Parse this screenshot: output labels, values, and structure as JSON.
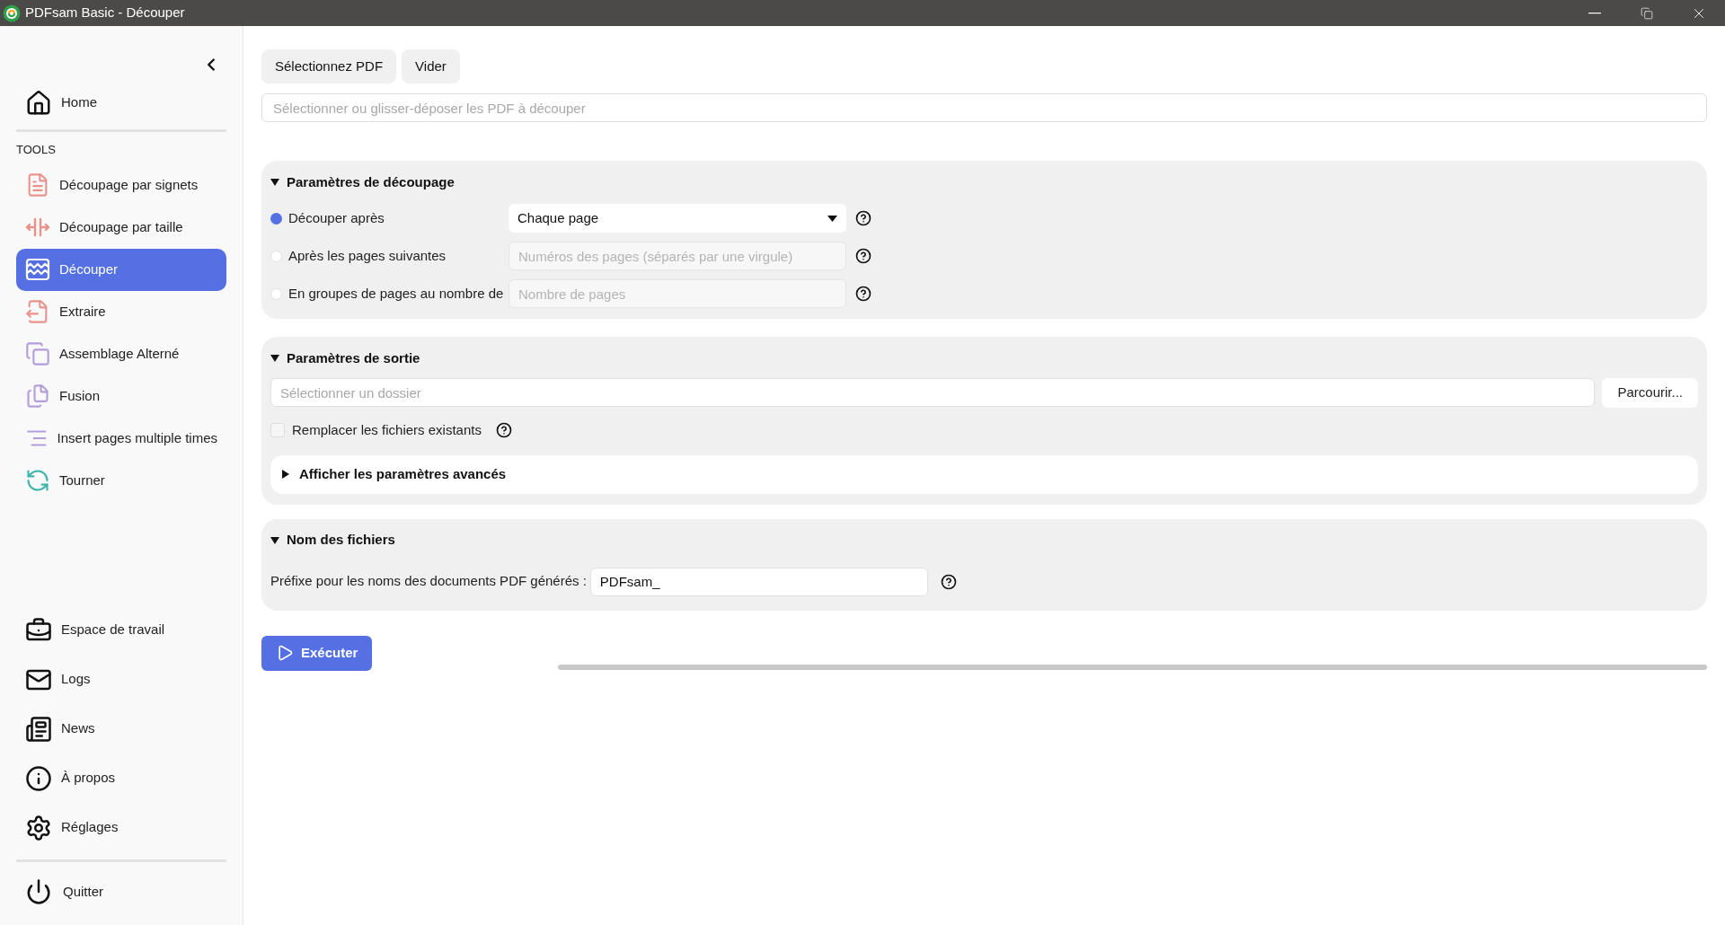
{
  "window": {
    "title": "PDFsam Basic - Découper"
  },
  "sidebar": {
    "top_items": [
      {
        "label": "Home",
        "selected": false
      }
    ],
    "section_label": "TOOLS",
    "tools": [
      {
        "label": "Découpage par signets",
        "selected": false
      },
      {
        "label": "Découpage par taille",
        "selected": false
      },
      {
        "label": "Découper",
        "selected": true
      },
      {
        "label": "Extraire",
        "selected": false
      },
      {
        "label": "Assemblage Alterné",
        "selected": false
      },
      {
        "label": "Fusion",
        "selected": false
      },
      {
        "label": "Insert pages multiple times",
        "selected": false
      },
      {
        "label": "Tourner",
        "selected": false
      }
    ],
    "bottom_items": [
      {
        "label": "Espace de travail",
        "selected": false
      },
      {
        "label": "Logs",
        "selected": false
      },
      {
        "label": "News",
        "selected": false
      },
      {
        "label": "À propos",
        "selected": false
      },
      {
        "label": "Réglages",
        "selected": false
      }
    ],
    "quit": {
      "label": "Quitter"
    }
  },
  "toolbar": {
    "buttons": [
      "Sélectionnez PDF",
      "Vider"
    ]
  },
  "drop_field": {
    "placeholder": "Sélectionner ou glisser-déposer les PDF à découper"
  },
  "split_settings": {
    "title": "Paramètres de découpage",
    "expanded": true,
    "options": [
      {
        "label": "Découper après",
        "selected": true,
        "kind": "select",
        "value": "Chaque page",
        "disabled": false
      },
      {
        "label": "Après les pages suivantes",
        "selected": false,
        "kind": "input",
        "placeholder": "Numéros des pages (séparés par une virgule)",
        "disabled": true
      },
      {
        "label": "En groupes de pages au nombre de",
        "selected": false,
        "kind": "input",
        "placeholder": "Nombre de pages",
        "disabled": true
      }
    ]
  },
  "output_settings": {
    "title": "Paramètres de sortie",
    "expanded": true,
    "folder_field": {
      "placeholder": "Sélectionner un dossier"
    },
    "browse_button": "Parcourir...",
    "overwrite": {
      "label": "Remplacer les fichiers existants",
      "checked": false
    },
    "advanced": {
      "title": "Afficher les paramètres avancés",
      "expanded": false
    }
  },
  "file_names": {
    "title": "Nom des fichiers",
    "expanded": true,
    "prefix_label": "Préfixe pour les noms des documents PDF générés :",
    "prefix_value": "PDFsam_"
  },
  "run_button": "Exécuter",
  "progress": {
    "level": 0
  }
}
